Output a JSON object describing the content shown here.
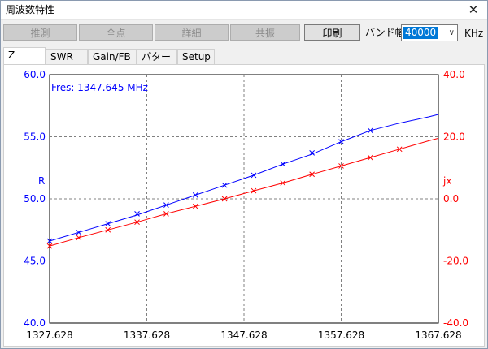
{
  "window": {
    "title": "周波数特性",
    "close_label": "✕"
  },
  "toolbar": {
    "buttons": [
      {
        "label": "推測",
        "enabled": false
      },
      {
        "label": "全点",
        "enabled": false
      },
      {
        "label": "詳細",
        "enabled": false
      },
      {
        "label": "共振",
        "enabled": false
      },
      {
        "label": "印刷",
        "enabled": true
      }
    ],
    "band_label": "バンド幅",
    "band_value": "40000",
    "band_unit": "KHz"
  },
  "tabs": [
    {
      "label": "Z",
      "active": true
    },
    {
      "label": "SWR",
      "active": false
    },
    {
      "label": "Gain/FB",
      "active": false
    },
    {
      "label": "パターン",
      "active": false
    },
    {
      "label": "Setup",
      "active": false
    }
  ],
  "colors": {
    "r_series": "#0000ff",
    "jx_series": "#ff0000",
    "grid": "#808080",
    "axis_left": "#0000ff",
    "axis_right": "#ff0000"
  },
  "chart_data": {
    "type": "line",
    "annotation": "Fres: 1347.645 MHz",
    "x_ticks": [
      "1327.628",
      "1337.628",
      "1347.628",
      "1357.628",
      "1367.628"
    ],
    "xlim": [
      1327.628,
      1367.628
    ],
    "ylim_left": [
      40,
      60
    ],
    "ylim_right": [
      -40,
      40
    ],
    "y_left_ticks": [
      "40.0",
      "45.0",
      "50.0",
      "55.0",
      "60.0"
    ],
    "y_right_ticks": [
      "-40.0",
      "-20.0",
      "0.0",
      "20.0",
      "40.0"
    ],
    "ylabel_left": "R",
    "ylabel_right": "jx",
    "grid": true,
    "series": [
      {
        "name": "R",
        "axis": "left",
        "x": [
          1327.628,
          1330.628,
          1333.628,
          1336.628,
          1339.628,
          1342.628,
          1345.628,
          1348.628,
          1351.628,
          1354.628,
          1357.628,
          1360.628,
          1363.628,
          1366.628,
          1367.628
        ],
        "y": [
          46.6,
          47.3,
          48.0,
          48.7,
          49.5,
          50.3,
          51.1,
          51.9,
          52.8,
          53.6,
          54.6,
          55.5,
          56.1,
          56.6,
          56.8
        ],
        "markers": [
          46.6,
          47.3,
          48.0,
          48.8,
          49.5,
          50.3,
          51.1,
          51.9,
          52.8,
          53.7,
          54.6,
          55.5
        ]
      },
      {
        "name": "jx",
        "axis": "right",
        "x": [
          1327.628,
          1330.628,
          1333.628,
          1336.628,
          1339.628,
          1342.628,
          1345.628,
          1348.628,
          1351.628,
          1354.628,
          1357.628,
          1360.628,
          1363.628,
          1366.628,
          1367.628
        ],
        "y": [
          -15.2,
          -12.5,
          -10.0,
          -7.5,
          -4.8,
          -2.4,
          0.0,
          2.6,
          5.1,
          7.9,
          10.6,
          13.3,
          16.0,
          18.7,
          19.5
        ],
        "markers": [
          -15.2,
          -12.5,
          -10.0,
          -7.5,
          -4.8,
          -2.4,
          0.0,
          2.6,
          5.1,
          7.9,
          10.6,
          13.3,
          16.0
        ]
      }
    ]
  }
}
